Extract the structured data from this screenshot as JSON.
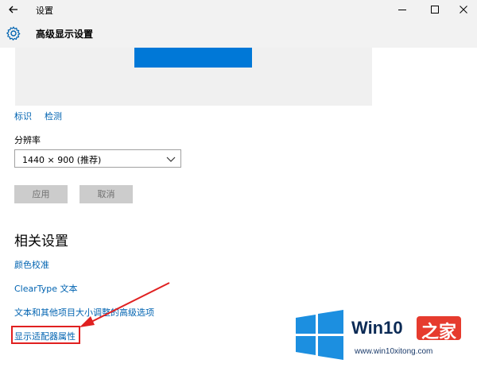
{
  "window": {
    "title": "设置"
  },
  "header": {
    "title": "高级显示设置"
  },
  "preview": {
    "links": [
      "标识",
      "检测"
    ]
  },
  "resolution": {
    "label": "分辨率",
    "value": "1440 × 900 (推荐)"
  },
  "buttons": {
    "apply": "应用",
    "cancel": "取消"
  },
  "related": {
    "title": "相关设置",
    "links": [
      "颜色校准",
      "ClearType 文本",
      "文本和其他项目大小调整的高级选项",
      "显示适配器属性"
    ]
  },
  "watermark": {
    "brand": "Win10",
    "brand_accent": "之家",
    "url": "www.win10xitong.com"
  },
  "colors": {
    "accent": "#0078d7",
    "link": "#0063b1",
    "highlight": "#e02020"
  },
  "icons": [
    "back-arrow-icon",
    "gear-icon",
    "minimize-icon",
    "maximize-icon",
    "close-icon",
    "chevron-down-icon",
    "windows-logo-icon"
  ]
}
